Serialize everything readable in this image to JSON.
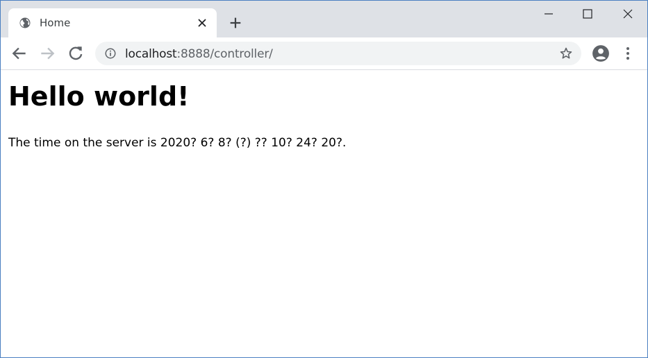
{
  "tab": {
    "title": "Home",
    "favicon": "globe-icon"
  },
  "address_bar": {
    "host": "localhost",
    "rest": ":8888/controller/"
  },
  "page": {
    "heading": "Hello world!",
    "paragraph": "The time on the server is 2020? 6? 8? (?) ?? 10? 24? 20?."
  },
  "colors": {
    "tabstrip": "#dee1e6",
    "omnibox": "#f1f3f4",
    "window_border": "#4a7fc1",
    "icon": "#5f6368"
  }
}
